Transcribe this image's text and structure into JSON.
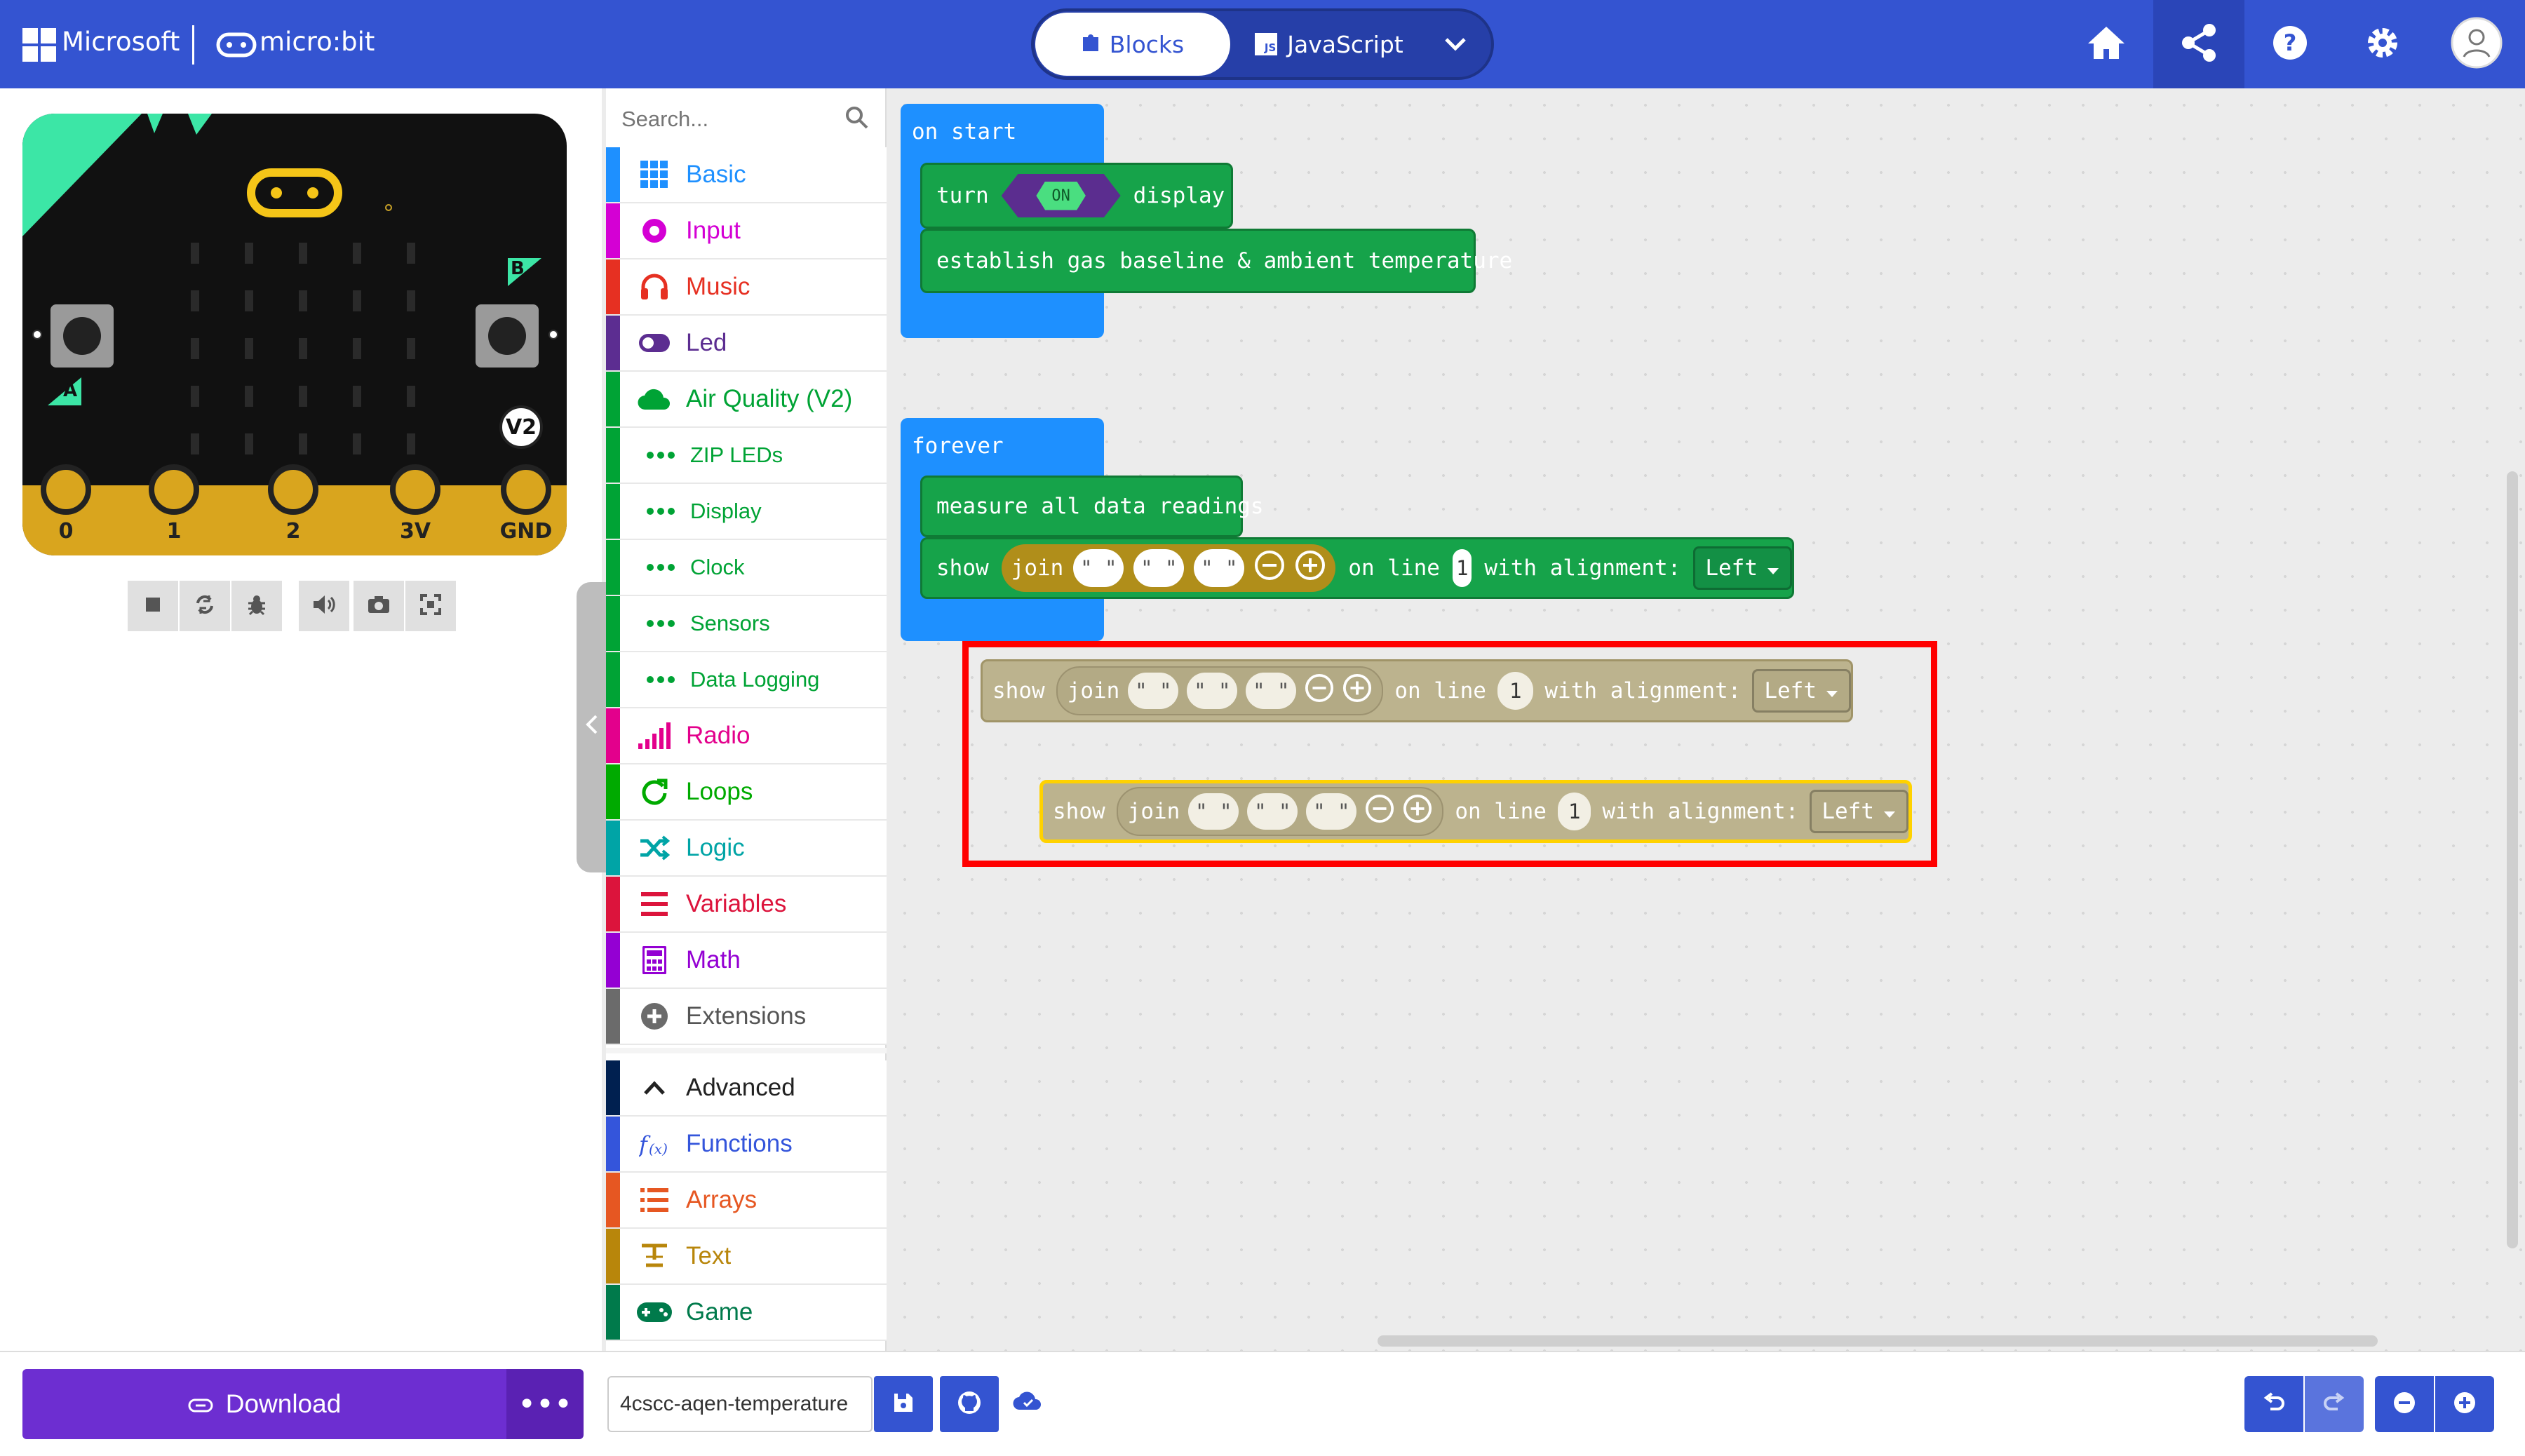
{
  "header": {
    "brand": "Microsoft",
    "product": "micro:bit",
    "tabs": {
      "blocks": "Blocks",
      "javascript": "JavaScript"
    },
    "js_badge": "JS"
  },
  "simulator": {
    "pins": [
      "0",
      "1",
      "2",
      "3V",
      "GND"
    ],
    "button_a": "A",
    "button_b": "B",
    "version": "V2"
  },
  "toolbox": {
    "search_placeholder": "Search...",
    "categories": [
      {
        "label": "Basic",
        "color": "#1e90ff"
      },
      {
        "label": "Input",
        "color": "#d400d4"
      },
      {
        "label": "Music",
        "color": "#e63022"
      },
      {
        "label": "Led",
        "color": "#5c2d91"
      },
      {
        "label": "Air Quality (V2)",
        "color": "#00a335"
      },
      {
        "label": "ZIP LEDs",
        "color": "#00a335"
      },
      {
        "label": "Display",
        "color": "#00a335"
      },
      {
        "label": "Clock",
        "color": "#00a335"
      },
      {
        "label": "Sensors",
        "color": "#00a335"
      },
      {
        "label": "Data Logging",
        "color": "#00a335"
      },
      {
        "label": "Radio",
        "color": "#e3008c"
      },
      {
        "label": "Loops",
        "color": "#00aa00"
      },
      {
        "label": "Logic",
        "color": "#00a4a6"
      },
      {
        "label": "Variables",
        "color": "#dc143c"
      },
      {
        "label": "Math",
        "color": "#9400d3"
      },
      {
        "label": "Extensions",
        "color": "#6b6b6b"
      },
      {
        "label": "Advanced",
        "color": "#002050"
      },
      {
        "label": "Functions",
        "color": "#3455db"
      },
      {
        "label": "Arrays",
        "color": "#e65722"
      },
      {
        "label": "Text",
        "color": "#b8860b"
      },
      {
        "label": "Game",
        "color": "#007a4b"
      }
    ]
  },
  "workspace": {
    "on_start": {
      "label": "on start",
      "turn": "turn",
      "on_toggle": "ON",
      "display": "display",
      "establish": "establish gas baseline & ambient temperature"
    },
    "forever": {
      "label": "forever",
      "measure": "measure all data readings",
      "show": "show",
      "join": "join",
      "on_line": "on line",
      "line_value": "1",
      "with_alignment": "with alignment:",
      "alignment_value": "Left"
    },
    "ghost_block_1": {
      "show": "show",
      "join": "join",
      "on_line": "on line",
      "line_value": "1",
      "with_alignment": "with alignment:",
      "alignment_value": "Left"
    },
    "ghost_block_2": {
      "show": "show",
      "join": "join",
      "on_line": "on line",
      "line_value": "1",
      "with_alignment": "with alignment:",
      "alignment_value": "Left"
    },
    "highlight_color": "#ff0000"
  },
  "footer": {
    "download": "Download",
    "more": "•••",
    "project_name": "4cscc-aqen-temperature"
  },
  "colors": {
    "header": "#3454d1",
    "download": "#6d2ed1",
    "blue_block": "#1e90ff",
    "green_block": "#16a34a",
    "join_block": "#b08e1a"
  }
}
